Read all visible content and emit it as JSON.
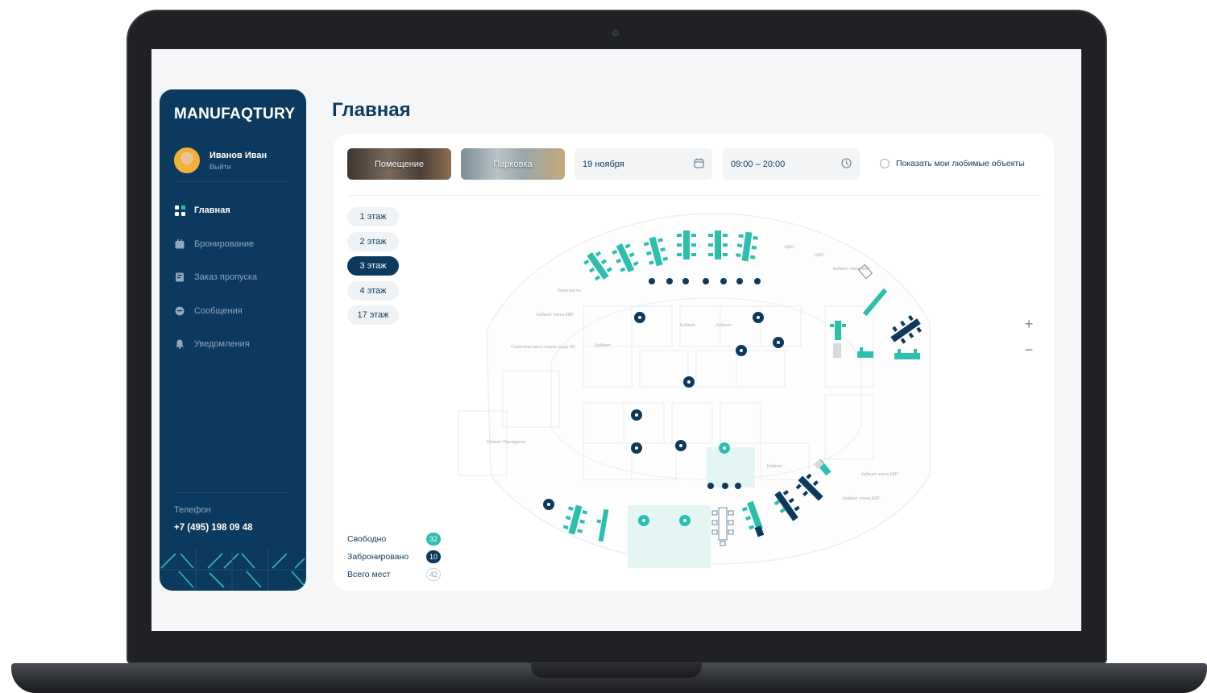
{
  "app": {
    "logo": "MANUFAQTURY",
    "user": {
      "name": "Иванов Иван",
      "logout": "Выйти"
    },
    "nav": [
      {
        "label": "Главная",
        "icon": "grid-icon",
        "active": true
      },
      {
        "label": "Бронирование",
        "icon": "calendar-icon",
        "active": false
      },
      {
        "label": "Заказ пропуска",
        "icon": "pass-icon",
        "active": false
      },
      {
        "label": "Сообщения",
        "icon": "chat-icon",
        "active": false
      },
      {
        "label": "Уведомления",
        "icon": "bell-icon",
        "active": false
      }
    ],
    "contact": {
      "label": "Телефон",
      "phone": "+7 (495) 198 09 48"
    }
  },
  "main": {
    "title": "Главная",
    "tabs": [
      {
        "label": "Помещение"
      },
      {
        "label": "Парковка"
      }
    ],
    "date": {
      "value": "19 ноября",
      "icon": "calendar-icon"
    },
    "time": {
      "value": "09:00 – 20:00",
      "icon": "clock-icon"
    },
    "favorites": {
      "label": "Показать мои любимые объекты",
      "checked": false
    },
    "floors": [
      {
        "label": "1 этаж",
        "active": false
      },
      {
        "label": "2 этаж",
        "active": false
      },
      {
        "label": "3 этаж",
        "active": true
      },
      {
        "label": "4 этаж",
        "active": false
      },
      {
        "label": "17 этаж",
        "active": false
      }
    ],
    "legend": {
      "free": {
        "label": "Свободно",
        "count": "32"
      },
      "booked": {
        "label": "Забронировано",
        "count": "10"
      },
      "total": {
        "label": "Всего мест",
        "count": "42"
      }
    },
    "zoom": {
      "in": "+",
      "out": "−"
    }
  },
  "floor_plan": {
    "room_labels": {
      "finance": "Финансисты",
      "cfo_1": "ЦФО",
      "cfo_2": "ЦФО",
      "emt_office_1": "Кабинет члена EMT",
      "emt_office_2": "Кабинет члена EMT",
      "emt_office_3": "Кабинет члена EMT",
      "emt_office_4": "Кабинет члена EMT",
      "office_1": "Кабинет",
      "office_2": "Кабинет",
      "office_3": "Кабинет",
      "office_4": "Кабинет",
      "construction": "Строительство и охрана труда HG",
      "president": "Кабинет Президента"
    },
    "colors": {
      "free": "#2cbfad",
      "booked": "#0c3a5e",
      "unavailable": "#d5dbdf"
    }
  }
}
